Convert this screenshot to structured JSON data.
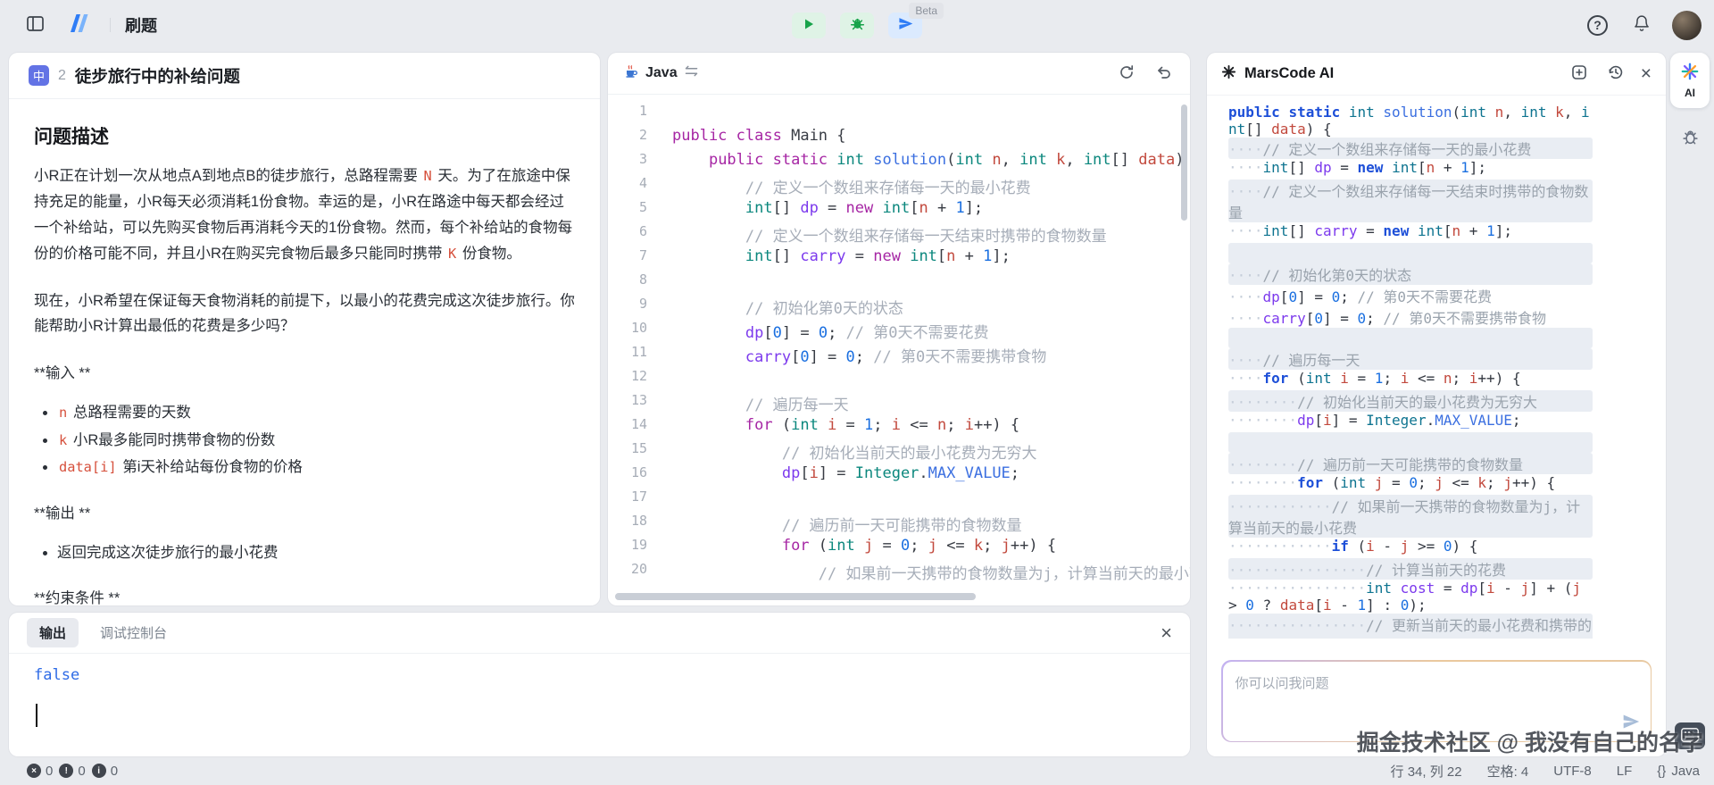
{
  "topbar": {
    "nav_title": "刷题",
    "beta_label": "Beta"
  },
  "icons": {
    "help": "?",
    "close": "×",
    "error": "×",
    "warning": "!",
    "info": "i",
    "braces": "{}"
  },
  "problem": {
    "difficulty": "中",
    "index": "2",
    "title": "徒步旅行中的补给问题",
    "section_heading": "问题描述",
    "p1": [
      {
        "text": "小R正在计划一次从地点A到地点B的徒步旅行，总路程需要 "
      },
      {
        "code": "N"
      },
      {
        "text": " 天。为了在旅途中保持充足的能量，小R每天必须消耗1份食物。幸运的是，小R在路途中每天都会经过一个补给站，可以先购买食物后再消耗今天的1份食物。然而，每个补给站的食物每份的价格可能不同，并且小R在购买完食物后最多只能同时携带 "
      },
      {
        "code": "K"
      },
      {
        "text": " 份食物。"
      }
    ],
    "p2": [
      {
        "text": "现在，小R希望在保证每天食物消耗的前提下，以最小的花费完成这次徒步旅行。你能帮助小R计算出最低的花费是多少吗？"
      }
    ],
    "input_label": "**输入 **",
    "input_items": [
      [
        {
          "code": "n"
        },
        {
          "text": " 总路程需要的天数"
        }
      ],
      [
        {
          "code": "k"
        },
        {
          "text": " 小R最多能同时携带食物的份数"
        }
      ],
      [
        {
          "code": "data[i]"
        },
        {
          "text": " 第i天补给站每份食物的价格"
        }
      ]
    ],
    "output_label": "**输出 **",
    "output_items": [
      [
        {
          "text": "返回完成这次徒步旅行的最小花费"
        }
      ]
    ],
    "constraints_label": "**约束条件 **"
  },
  "editor": {
    "language": "Java",
    "lines": [
      "",
      "public class Main {",
      "    public static int solution(int n, int k, int[] data) {",
      "        // 定义一个数组来存储每一天的最小花费",
      "        int[] dp = new int[n + 1];",
      "        // 定义一个数组来存储每一天结束时携带的食物数量",
      "        int[] carry = new int[n + 1];",
      "",
      "        // 初始化第0天的状态",
      "        dp[0] = 0; // 第0天不需要花费",
      "        carry[0] = 0; // 第0天不需要携带食物",
      "",
      "        // 遍历每一天",
      "        for (int i = 1; i <= n; i++) {",
      "            // 初始化当前天的最小花费为无穷大",
      "            dp[i] = Integer.MAX_VALUE;",
      "",
      "            // 遍历前一天可能携带的食物数量",
      "            for (int j = 0; j <= k; j++) {",
      "                // 如果前一天携带的食物数量为j，计算当前天的最小花"
    ]
  },
  "console": {
    "tab_output": "输出",
    "tab_debug": "调试控制台",
    "result": "false"
  },
  "ai": {
    "title": "MarsCode AI",
    "input_placeholder": "你可以问我问题",
    "code_lines": [
      {
        "hl": false,
        "text": "public static int solution(int n, int k, int[] data) {"
      },
      {
        "hl": true,
        "text": "    // 定义一个数组来存储每一天的最小花费"
      },
      {
        "hl": false,
        "text": "    int[] dp = new int[n + 1];"
      },
      {
        "hl": true,
        "text": "    // 定义一个数组来存储每一天结束时携带的食物数量"
      },
      {
        "hl": false,
        "text": "    int[] carry = new int[n + 1];"
      },
      {
        "hl": true,
        "text": ""
      },
      {
        "hl": true,
        "text": "    // 初始化第0天的状态"
      },
      {
        "hl": false,
        "text": "    dp[0] = 0; // 第0天不需要花费"
      },
      {
        "hl": false,
        "text": "    carry[0] = 0; // 第0天不需要携带食物"
      },
      {
        "hl": true,
        "text": ""
      },
      {
        "hl": true,
        "text": "    // 遍历每一天"
      },
      {
        "hl": false,
        "text": "    for (int i = 1; i <= n; i++) {"
      },
      {
        "hl": true,
        "text": "        // 初始化当前天的最小花费为无穷大"
      },
      {
        "hl": false,
        "text": "        dp[i] = Integer.MAX_VALUE;"
      },
      {
        "hl": true,
        "text": ""
      },
      {
        "hl": true,
        "text": "        // 遍历前一天可能携带的食物数量"
      },
      {
        "hl": false,
        "text": "        for (int j = 0; j <= k; j++) {"
      },
      {
        "hl": true,
        "text": "            // 如果前一天携带的食物数量为j，计算当前天的最小花费"
      },
      {
        "hl": false,
        "text": "            if (i - j >= 0) {"
      },
      {
        "hl": true,
        "text": "                // 计算当前天的花费"
      },
      {
        "hl": false,
        "text": "                int cost = dp[i - j] + (j > 0 ? data[i - 1] : 0);"
      },
      {
        "hl": true,
        "text": "                // 更新当前天的最小花费和携带的食物数量"
      }
    ]
  },
  "right_strip": {
    "ai_label": "AI"
  },
  "statusbar": {
    "errors": "0",
    "warnings": "0",
    "infos": "0",
    "cursor": "行 34, 列 22",
    "spaces": "空格: 4",
    "encoding": "UTF-8",
    "eol": "LF",
    "language": "Java"
  },
  "watermark": "掘金技术社区 @ 我没有自己的名字"
}
